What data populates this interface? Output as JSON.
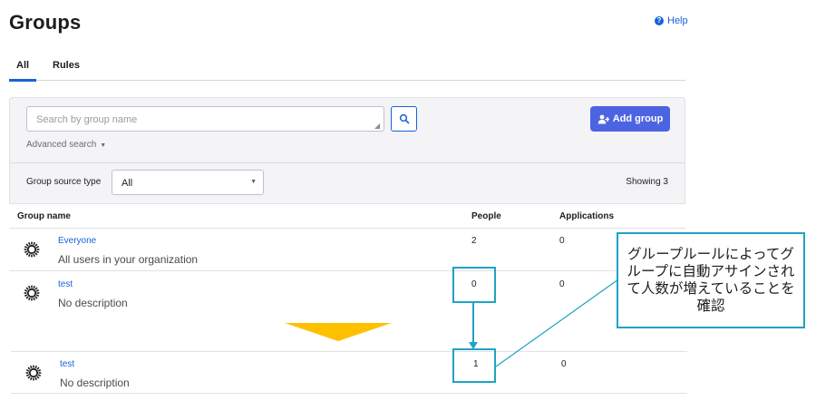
{
  "page": {
    "title": "Groups",
    "help_label": "Help"
  },
  "tabs": [
    {
      "label": "All",
      "active": true
    },
    {
      "label": "Rules",
      "active": false
    }
  ],
  "search": {
    "placeholder": "Search by group name",
    "advanced_label": "Advanced search"
  },
  "actions": {
    "add_group_label": "Add group"
  },
  "filters": {
    "source_type_label": "Group source type",
    "source_type_value": "All",
    "showing_label": "Showing 3"
  },
  "table": {
    "columns": [
      "Group name",
      "People",
      "Applications"
    ],
    "rows": [
      {
        "name": "Everyone",
        "description": "All users in your organization",
        "people": "2",
        "applications": "0"
      },
      {
        "name": "test",
        "description": "No description",
        "people": "0",
        "applications": "0"
      }
    ]
  },
  "after": {
    "row": {
      "name": "test",
      "description": "No description",
      "people": "1",
      "applications": "0"
    }
  },
  "annotation": {
    "callout_text": "グループルールによってグループに自動アサインされて人数が増えていることを確認",
    "highlight_color": "#1fa3c4",
    "arrow_color": "#ffc000"
  },
  "colors": {
    "accent": "#4c64e2",
    "link": "#1662dd"
  },
  "icons": {
    "help": "help-circle-icon",
    "search": "search-icon",
    "add_group": "add-group-icon",
    "group": "group-sun-icon",
    "caret": "caret-down-icon"
  }
}
